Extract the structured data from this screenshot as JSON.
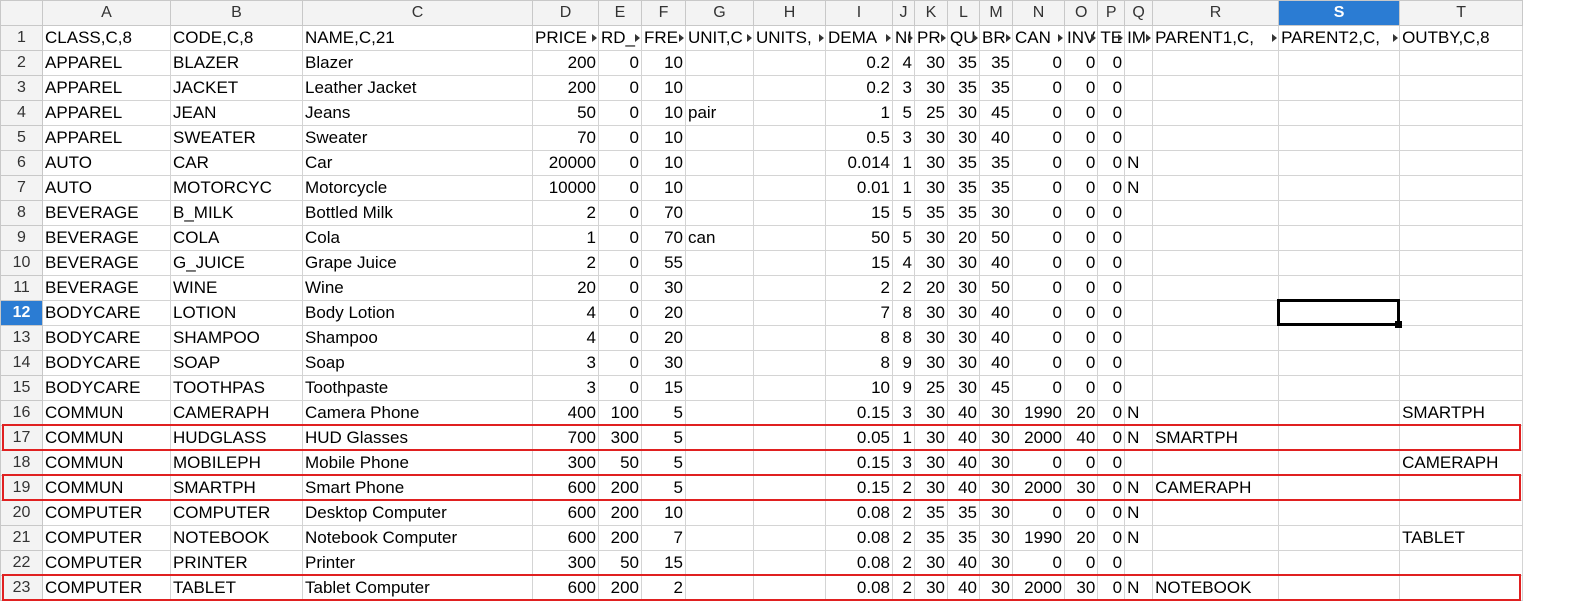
{
  "sheet": {
    "columns": [
      "A",
      "B",
      "C",
      "D",
      "E",
      "F",
      "G",
      "H",
      "I",
      "J",
      "K",
      "L",
      "M",
      "N",
      "O",
      "P",
      "Q",
      "R",
      "S",
      "T"
    ],
    "selected_column": "S",
    "selected_row": 12,
    "header_row": [
      "CLASS,C,8",
      "CODE,C,8",
      "NAME,C,21",
      "PRICE",
      "RD_",
      "FRE",
      "UNIT,C",
      "UNITS,",
      "DEMA",
      "NI",
      "PR",
      "QU",
      "BR",
      "CAN",
      "INV",
      "TE",
      "IM",
      "PARENT1,C,",
      "PARENT2,C,",
      "OUTBY,C,8"
    ],
    "header_has_overflow": [
      false,
      false,
      false,
      true,
      true,
      true,
      true,
      true,
      true,
      true,
      true,
      true,
      true,
      true,
      true,
      true,
      true,
      true,
      true,
      false
    ],
    "rows": [
      [
        "APPAREL",
        "BLAZER",
        "Blazer",
        "200",
        "0",
        "10",
        "",
        "",
        "0.2",
        "4",
        "30",
        "35",
        "35",
        "0",
        "0",
        "0",
        "",
        "",
        "",
        ""
      ],
      [
        "APPAREL",
        "JACKET",
        "Leather Jacket",
        "200",
        "0",
        "10",
        "",
        "",
        "0.2",
        "3",
        "30",
        "35",
        "35",
        "0",
        "0",
        "0",
        "",
        "",
        "",
        ""
      ],
      [
        "APPAREL",
        "JEAN",
        "Jeans",
        "50",
        "0",
        "10",
        "pair",
        "",
        "1",
        "5",
        "25",
        "30",
        "45",
        "0",
        "0",
        "0",
        "",
        "",
        "",
        ""
      ],
      [
        "APPAREL",
        "SWEATER",
        "Sweater",
        "70",
        "0",
        "10",
        "",
        "",
        "0.5",
        "3",
        "30",
        "30",
        "40",
        "0",
        "0",
        "0",
        "",
        "",
        "",
        ""
      ],
      [
        "AUTO",
        "CAR",
        "Car",
        "20000",
        "0",
        "10",
        "",
        "",
        "0.014",
        "1",
        "30",
        "35",
        "35",
        "0",
        "0",
        "0",
        "N",
        "",
        "",
        ""
      ],
      [
        "AUTO",
        "MOTORCYC",
        "Motorcycle",
        "10000",
        "0",
        "10",
        "",
        "",
        "0.01",
        "1",
        "30",
        "35",
        "35",
        "0",
        "0",
        "0",
        "N",
        "",
        "",
        ""
      ],
      [
        "BEVERAGE",
        "B_MILK",
        "Bottled Milk",
        "2",
        "0",
        "70",
        "",
        "",
        "15",
        "5",
        "35",
        "35",
        "30",
        "0",
        "0",
        "0",
        "",
        "",
        "",
        ""
      ],
      [
        "BEVERAGE",
        "COLA",
        "Cola",
        "1",
        "0",
        "70",
        "can",
        "",
        "50",
        "5",
        "30",
        "20",
        "50",
        "0",
        "0",
        "0",
        "",
        "",
        "",
        ""
      ],
      [
        "BEVERAGE",
        "G_JUICE",
        "Grape Juice",
        "2",
        "0",
        "55",
        "",
        "",
        "15",
        "4",
        "30",
        "30",
        "40",
        "0",
        "0",
        "0",
        "",
        "",
        "",
        ""
      ],
      [
        "BEVERAGE",
        "WINE",
        "Wine",
        "20",
        "0",
        "30",
        "",
        "",
        "2",
        "2",
        "20",
        "30",
        "50",
        "0",
        "0",
        "0",
        "",
        "",
        "",
        ""
      ],
      [
        "BODYCARE",
        "LOTION",
        "Body Lotion",
        "4",
        "0",
        "20",
        "",
        "",
        "7",
        "8",
        "30",
        "30",
        "40",
        "0",
        "0",
        "0",
        "",
        "",
        "",
        ""
      ],
      [
        "BODYCARE",
        "SHAMPOO",
        "Shampoo",
        "4",
        "0",
        "20",
        "",
        "",
        "8",
        "8",
        "30",
        "30",
        "40",
        "0",
        "0",
        "0",
        "",
        "",
        "",
        ""
      ],
      [
        "BODYCARE",
        "SOAP",
        "Soap",
        "3",
        "0",
        "30",
        "",
        "",
        "8",
        "9",
        "30",
        "30",
        "40",
        "0",
        "0",
        "0",
        "",
        "",
        "",
        ""
      ],
      [
        "BODYCARE",
        "TOOTHPAS",
        "Toothpaste",
        "3",
        "0",
        "15",
        "",
        "",
        "10",
        "9",
        "25",
        "30",
        "45",
        "0",
        "0",
        "0",
        "",
        "",
        "",
        ""
      ],
      [
        "COMMUN",
        "CAMERAPH",
        "Camera Phone",
        "400",
        "100",
        "5",
        "",
        "",
        "0.15",
        "3",
        "30",
        "40",
        "30",
        "1990",
        "20",
        "0",
        "N",
        "",
        "",
        "SMARTPH"
      ],
      [
        "COMMUN",
        "HUDGLASS",
        "HUD Glasses",
        "700",
        "300",
        "5",
        "",
        "",
        "0.05",
        "1",
        "30",
        "40",
        "30",
        "2000",
        "40",
        "0",
        "N",
        "SMARTPH",
        "",
        ""
      ],
      [
        "COMMUN",
        "MOBILEPH",
        "Mobile Phone",
        "300",
        "50",
        "5",
        "",
        "",
        "0.15",
        "3",
        "30",
        "40",
        "30",
        "0",
        "0",
        "0",
        "",
        "",
        "",
        "CAMERAPH"
      ],
      [
        "COMMUN",
        "SMARTPH",
        "Smart Phone",
        "600",
        "200",
        "5",
        "",
        "",
        "0.15",
        "2",
        "30",
        "40",
        "30",
        "2000",
        "30",
        "0",
        "N",
        "CAMERAPH",
        "",
        ""
      ],
      [
        "COMPUTER",
        "COMPUTER",
        "Desktop Computer",
        "600",
        "200",
        "10",
        "",
        "",
        "0.08",
        "2",
        "35",
        "35",
        "30",
        "0",
        "0",
        "0",
        "N",
        "",
        "",
        ""
      ],
      [
        "COMPUTER",
        "NOTEBOOK",
        "Notebook Computer",
        "600",
        "200",
        "7",
        "",
        "",
        "0.08",
        "2",
        "35",
        "35",
        "30",
        "1990",
        "20",
        "0",
        "N",
        "",
        "",
        "TABLET"
      ],
      [
        "COMPUTER",
        "PRINTER",
        "Printer",
        "300",
        "50",
        "15",
        "",
        "",
        "0.08",
        "2",
        "30",
        "40",
        "30",
        "0",
        "0",
        "0",
        "",
        "",
        "",
        ""
      ],
      [
        "COMPUTER",
        "TABLET",
        "Tablet Computer",
        "600",
        "200",
        "2",
        "",
        "",
        "0.08",
        "2",
        "30",
        "40",
        "30",
        "2000",
        "30",
        "0",
        "N",
        "NOTEBOOK",
        "",
        ""
      ]
    ],
    "numeric_columns": [
      3,
      4,
      5,
      8,
      9,
      10,
      11,
      12,
      13,
      14,
      15
    ],
    "highlighted_rows": [
      17,
      19,
      23
    ],
    "highlight_color": "#e02020",
    "selection_color": "#2b7cd3"
  }
}
